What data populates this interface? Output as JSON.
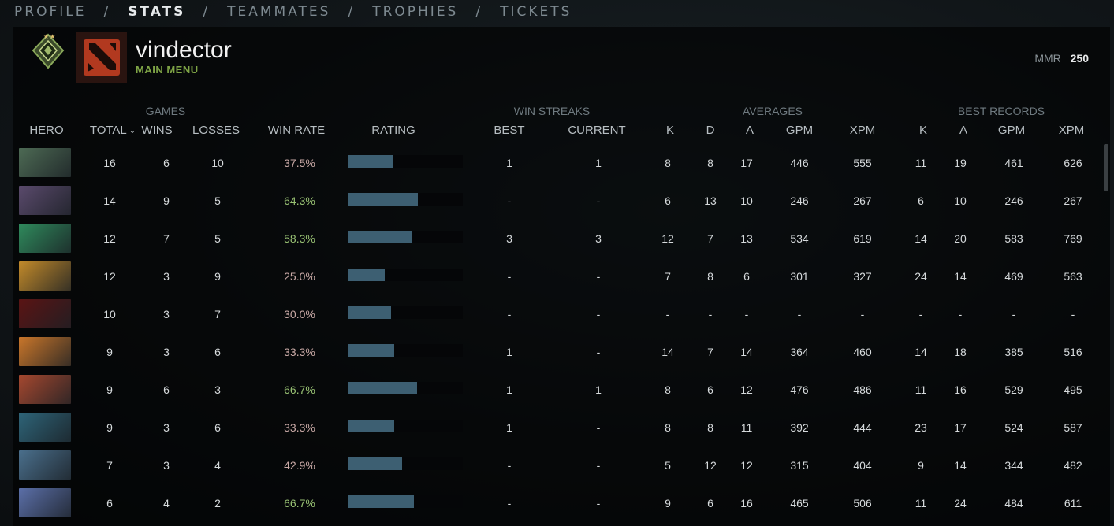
{
  "nav": {
    "items": [
      {
        "label": "PROFILE",
        "active": false
      },
      {
        "label": "STATS",
        "active": true
      },
      {
        "label": "TEAMMATES",
        "active": false
      },
      {
        "label": "TROPHIES",
        "active": false
      },
      {
        "label": "TICKETS",
        "active": false
      }
    ],
    "separator": "/"
  },
  "profile": {
    "name": "vindector",
    "status": "MAIN MENU",
    "mmr_label": "MMR",
    "mmr_value": "250",
    "rank_badge_icon": "rank-medal-icon",
    "avatar_icon": "dota2-logo-icon"
  },
  "groups": {
    "games": "GAMES",
    "win_streaks": "WIN STREAKS",
    "averages": "AVERAGES",
    "best_records": "BEST RECORDS"
  },
  "columns": {
    "hero": "HERO",
    "total": "TOTAL",
    "wins": "WINS",
    "losses": "LOSSES",
    "win_rate": "WIN RATE",
    "rating": "RATING",
    "best": "BEST",
    "current": "CURRENT",
    "avg_k": "K",
    "avg_d": "D",
    "avg_a": "A",
    "avg_gpm": "GPM",
    "avg_xpm": "XPM",
    "best_k": "K",
    "best_a": "A",
    "best_gpm": "GPM",
    "best_xpm": "XPM"
  },
  "sort_icon": "chevron-down-icon",
  "colors": {
    "win_rate_good": "#99c274",
    "win_rate_bad": "#c9a9a6",
    "rating_bar": "#3d5f72",
    "status_green": "#7fa546"
  },
  "rows": [
    {
      "hero_icon": "hero-portrait-icon",
      "hero_color": "#4d6a54",
      "total": "16",
      "wins": "6",
      "losses": "10",
      "win_rate": "37.5%",
      "good": false,
      "rating": 0.39,
      "best": "1",
      "current": "1",
      "avg_k": "8",
      "avg_d": "8",
      "avg_a": "17",
      "avg_gpm": "446",
      "avg_xpm": "555",
      "best_k": "11",
      "best_a": "19",
      "best_gpm": "461",
      "best_xpm": "626"
    },
    {
      "hero_icon": "hero-portrait-icon",
      "hero_color": "#5a4a6c",
      "total": "14",
      "wins": "9",
      "losses": "5",
      "win_rate": "64.3%",
      "good": true,
      "rating": 0.61,
      "best": "-",
      "current": "-",
      "avg_k": "6",
      "avg_d": "13",
      "avg_a": "10",
      "avg_gpm": "246",
      "avg_xpm": "267",
      "best_k": "6",
      "best_a": "10",
      "best_gpm": "246",
      "best_xpm": "267"
    },
    {
      "hero_icon": "hero-portrait-icon",
      "hero_color": "#2f8a5c",
      "total": "12",
      "wins": "7",
      "losses": "5",
      "win_rate": "58.3%",
      "good": true,
      "rating": 0.56,
      "best": "3",
      "current": "3",
      "avg_k": "12",
      "avg_d": "7",
      "avg_a": "13",
      "avg_gpm": "534",
      "avg_xpm": "619",
      "best_k": "14",
      "best_a": "20",
      "best_gpm": "583",
      "best_xpm": "769"
    },
    {
      "hero_icon": "hero-portrait-icon",
      "hero_color": "#c28a2a",
      "total": "12",
      "wins": "3",
      "losses": "9",
      "win_rate": "25.0%",
      "good": false,
      "rating": 0.32,
      "best": "-",
      "current": "-",
      "avg_k": "7",
      "avg_d": "8",
      "avg_a": "6",
      "avg_gpm": "301",
      "avg_xpm": "327",
      "best_k": "24",
      "best_a": "14",
      "best_gpm": "469",
      "best_xpm": "563"
    },
    {
      "hero_icon": "hero-portrait-icon",
      "hero_color": "#5a1414",
      "total": "10",
      "wins": "3",
      "losses": "7",
      "win_rate": "30.0%",
      "good": false,
      "rating": 0.37,
      "best": "-",
      "current": "-",
      "avg_k": "-",
      "avg_d": "-",
      "avg_a": "-",
      "avg_gpm": "-",
      "avg_xpm": "-",
      "best_k": "-",
      "best_a": "-",
      "best_gpm": "-",
      "best_xpm": "-"
    },
    {
      "hero_icon": "hero-portrait-icon",
      "hero_color": "#c9762a",
      "total": "9",
      "wins": "3",
      "losses": "6",
      "win_rate": "33.3%",
      "good": false,
      "rating": 0.4,
      "best": "1",
      "current": "-",
      "avg_k": "14",
      "avg_d": "7",
      "avg_a": "14",
      "avg_gpm": "364",
      "avg_xpm": "460",
      "best_k": "14",
      "best_a": "18",
      "best_gpm": "385",
      "best_xpm": "516"
    },
    {
      "hero_icon": "hero-portrait-icon",
      "hero_color": "#a5482f",
      "total": "9",
      "wins": "6",
      "losses": "3",
      "win_rate": "66.7%",
      "good": true,
      "rating": 0.6,
      "best": "1",
      "current": "1",
      "avg_k": "8",
      "avg_d": "6",
      "avg_a": "12",
      "avg_gpm": "476",
      "avg_xpm": "486",
      "best_k": "11",
      "best_a": "16",
      "best_gpm": "529",
      "best_xpm": "495"
    },
    {
      "hero_icon": "hero-portrait-icon",
      "hero_color": "#2e6478",
      "total": "9",
      "wins": "3",
      "losses": "6",
      "win_rate": "33.3%",
      "good": false,
      "rating": 0.4,
      "best": "1",
      "current": "-",
      "avg_k": "8",
      "avg_d": "8",
      "avg_a": "11",
      "avg_gpm": "392",
      "avg_xpm": "444",
      "best_k": "23",
      "best_a": "17",
      "best_gpm": "524",
      "best_xpm": "587"
    },
    {
      "hero_icon": "hero-portrait-icon",
      "hero_color": "#4a6f8c",
      "total": "7",
      "wins": "3",
      "losses": "4",
      "win_rate": "42.9%",
      "good": false,
      "rating": 0.47,
      "best": "-",
      "current": "-",
      "avg_k": "5",
      "avg_d": "12",
      "avg_a": "12",
      "avg_gpm": "315",
      "avg_xpm": "404",
      "best_k": "9",
      "best_a": "14",
      "best_gpm": "344",
      "best_xpm": "482"
    },
    {
      "hero_icon": "hero-portrait-icon",
      "hero_color": "#5b6fa8",
      "total": "6",
      "wins": "4",
      "losses": "2",
      "win_rate": "66.7%",
      "good": true,
      "rating": 0.57,
      "best": "-",
      "current": "-",
      "avg_k": "9",
      "avg_d": "6",
      "avg_a": "16",
      "avg_gpm": "465",
      "avg_xpm": "506",
      "best_k": "11",
      "best_a": "24",
      "best_gpm": "484",
      "best_xpm": "611"
    }
  ]
}
